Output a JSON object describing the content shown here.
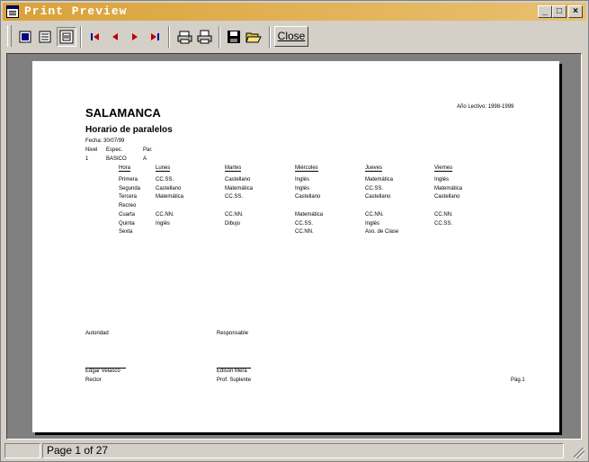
{
  "window": {
    "title": "Print Preview",
    "minimize": "_",
    "maximize": "□",
    "close": "×"
  },
  "toolbar": {
    "close_label": "Close"
  },
  "report": {
    "title": "SALAMANCA",
    "year_label": "Año Lectivo: 1998-1999",
    "subtitle": "Horario de paralelos",
    "fecha": "Fecha: 30/07/99",
    "header_cols": [
      "Nivel",
      "Espec.",
      "Par."
    ],
    "row_values": [
      "1",
      "BASICO",
      "A"
    ],
    "schedule": {
      "columns": [
        "Hora",
        "Lunes",
        "Martes",
        "Miércoles",
        "Jueves",
        "Viernes"
      ],
      "rows": [
        [
          "Primera",
          "CC.SS.",
          "Castellano",
          "Inglés",
          "Matemática",
          "Inglés"
        ],
        [
          "Segunda",
          "Castellano",
          "Matemática",
          "Inglés",
          "CC.SS.",
          "Matemática"
        ],
        [
          "Tercera",
          "Matemática",
          "CC.SS.",
          "Castellano",
          "Castellano",
          "Castellano"
        ],
        [
          "Recreo",
          "",
          "",
          "",
          "",
          ""
        ],
        [
          "Cuarta",
          "CC.NN.",
          "CC.NN.",
          "Matemática",
          "CC.NN.",
          "CC.NN."
        ],
        [
          "Quinta",
          "Inglés",
          "Dibujo",
          "CC.SS.",
          "Inglés",
          "CC.SS."
        ],
        [
          "Sexta",
          "",
          "",
          "CC.NN.",
          "Aso. de Clase",
          ""
        ]
      ]
    },
    "footer": {
      "autoridad_label": "Autoridad",
      "responsable_label": "Responsable",
      "autoridad_name": "Edgar Velasco",
      "autoridad_role": "Rector",
      "responsable_name": "Edison Mera",
      "responsable_role": "Prof. Suplente",
      "page_mark": "Pág.1"
    }
  },
  "status": {
    "page_text": "Page 1 of 27"
  }
}
